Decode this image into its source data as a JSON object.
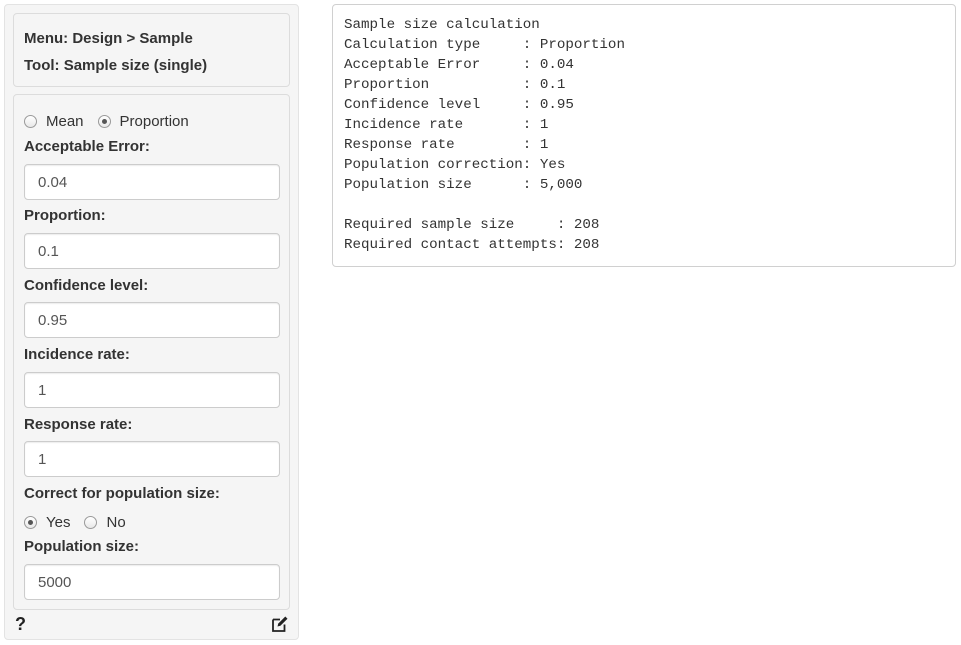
{
  "menu": {
    "menu_line": "Menu: Design > Sample",
    "tool_line": "Tool: Sample size (single)"
  },
  "calc_type": {
    "options": [
      {
        "label": "Mean",
        "checked": false
      },
      {
        "label": "Proportion",
        "checked": true
      }
    ]
  },
  "fields": {
    "acceptable_error": {
      "label": "Acceptable Error:",
      "value": "0.04"
    },
    "proportion": {
      "label": "Proportion:",
      "value": "0.1"
    },
    "confidence_level": {
      "label": "Confidence level:",
      "value": "0.95"
    },
    "incidence_rate": {
      "label": "Incidence rate:",
      "value": "1"
    },
    "response_rate": {
      "label": "Response rate:",
      "value": "1"
    },
    "population_size": {
      "label": "Population size:",
      "value": "5000"
    }
  },
  "population_correction": {
    "label": "Correct for population size:",
    "options": [
      {
        "label": "Yes",
        "checked": true
      },
      {
        "label": "No",
        "checked": false
      }
    ]
  },
  "footer": {
    "help_icon": "?",
    "edit_icon": "edit-icon"
  },
  "output": {
    "text": "Sample size calculation\nCalculation type     : Proportion\nAcceptable Error     : 0.04\nProportion           : 0.1\nConfidence level     : 0.95\nIncidence rate       : 1\nResponse rate        : 1\nPopulation correction: Yes\nPopulation size      : 5,000\n\nRequired sample size     : 208\nRequired contact attempts: 208"
  }
}
